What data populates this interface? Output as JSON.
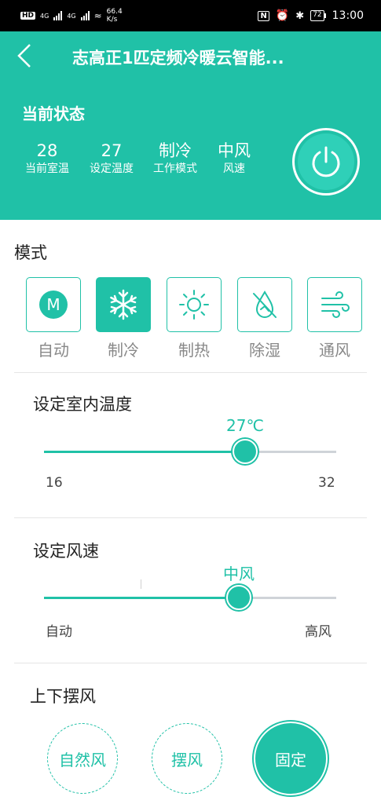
{
  "status_bar": {
    "hd": "HD",
    "net1": "4G",
    "net2": "4G",
    "speed_value": "66.4",
    "speed_unit": "K/s",
    "battery": "72",
    "time": "13:00"
  },
  "header": {
    "title": "志高正1匹定频冷暖云智能...",
    "state_title": "当前状态",
    "stats": [
      {
        "value": "28",
        "label": "当前室温"
      },
      {
        "value": "27",
        "label": "设定温度"
      },
      {
        "value": "制冷",
        "label": "工作模式"
      },
      {
        "value": "中风",
        "label": "风速"
      }
    ]
  },
  "mode": {
    "title": "模式",
    "items": [
      {
        "label": "自动",
        "icon": "auto-m-icon",
        "active": false
      },
      {
        "label": "制冷",
        "icon": "snowflake-icon",
        "active": true
      },
      {
        "label": "制热",
        "icon": "sun-icon",
        "active": false
      },
      {
        "label": "除湿",
        "icon": "dehumidify-icon",
        "active": false
      },
      {
        "label": "通风",
        "icon": "wind-icon",
        "active": false
      }
    ]
  },
  "temperature": {
    "title": "设定室内温度",
    "value": "27℃",
    "min": "16",
    "max": "32",
    "current": 27
  },
  "fan_speed": {
    "title": "设定风速",
    "value": "中风",
    "min": "自动",
    "max": "高风",
    "level_fraction": 0.67
  },
  "swing": {
    "title": "上下摆风",
    "buttons": [
      {
        "label": "自然风",
        "active": false
      },
      {
        "label": "摆风",
        "active": false
      },
      {
        "label": "固定",
        "active": true
      }
    ]
  },
  "colors": {
    "accent": "#20c1a7",
    "track": "#cfd3d8"
  }
}
